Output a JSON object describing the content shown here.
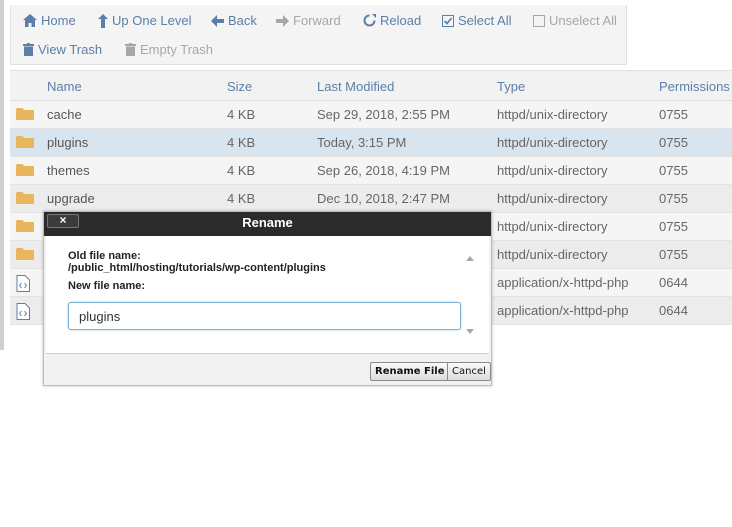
{
  "toolbar": {
    "home": "Home",
    "up_one_level": "Up One Level",
    "back": "Back",
    "forward": "Forward",
    "reload": "Reload",
    "select_all": "Select All",
    "unselect_all": "Unselect All",
    "view_trash": "View Trash",
    "empty_trash": "Empty Trash"
  },
  "table": {
    "headers": {
      "name": "Name",
      "size": "Size",
      "last_modified": "Last Modified",
      "type": "Type",
      "permissions": "Permissions"
    },
    "rows": [
      {
        "icon": "folder-icon",
        "name": "cache",
        "size": "4 KB",
        "modified": "Sep 29, 2018, 2:55 PM",
        "type": "httpd/unix-directory",
        "perms": "0755"
      },
      {
        "icon": "folder-icon",
        "name": "plugins",
        "size": "4 KB",
        "modified": "Today, 3:15 PM",
        "type": "httpd/unix-directory",
        "perms": "0755"
      },
      {
        "icon": "folder-icon",
        "name": "themes",
        "size": "4 KB",
        "modified": "Sep 26, 2018, 4:19 PM",
        "type": "httpd/unix-directory",
        "perms": "0755"
      },
      {
        "icon": "folder-icon",
        "name": "upgrade",
        "size": "4 KB",
        "modified": "Dec 10, 2018, 2:47 PM",
        "type": "httpd/unix-directory",
        "perms": "0755"
      },
      {
        "icon": "folder-icon",
        "name": "",
        "size": "",
        "modified": "",
        "type": "httpd/unix-directory",
        "perms": "0755"
      },
      {
        "icon": "folder-icon",
        "name": "",
        "size": "",
        "modified": "",
        "type": "httpd/unix-directory",
        "perms": "0755"
      },
      {
        "icon": "php-file-icon",
        "name": "",
        "size": "",
        "modified": "",
        "type": "application/x-httpd-php",
        "perms": "0644"
      },
      {
        "icon": "php-file-icon",
        "name": "",
        "size": "",
        "modified": "",
        "type": "application/x-httpd-php",
        "perms": "0644"
      }
    ]
  },
  "dialog": {
    "title": "Rename",
    "close_label": "×",
    "old_name_label": "Old file name:",
    "old_name_path": "/public_html/hosting/tutorials/wp-content/plugins",
    "new_name_label": "New file name:",
    "new_name_value": "plugins",
    "rename_button": "Rename File",
    "cancel_button": "Cancel"
  },
  "colors": {
    "link": "#5a7fa8",
    "disabled": "#a7a7a7",
    "folder": "#e8b65c",
    "selected_row": "#d8e4ee",
    "dialog_title_bg": "#2b2b2b"
  }
}
